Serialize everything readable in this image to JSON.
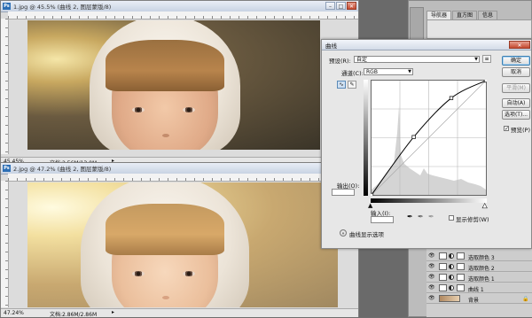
{
  "doc1": {
    "title": "1.jpg @ 45.5% (曲线 2, 图层蒙版/8)",
    "zoom": "45.45%",
    "info": "文档:2.56M/13.0M"
  },
  "doc2": {
    "title": "2.jpg @ 47.2% (曲线 2, 图层蒙版/8)",
    "zoom": "47.24%",
    "info": "文档:2.86M/2.86M"
  },
  "panel_tabs": [
    {
      "label": "导航器",
      "active": true
    },
    {
      "label": "直方图",
      "active": false
    },
    {
      "label": "信息",
      "active": false
    }
  ],
  "curves": {
    "title": "曲线",
    "preset_label": "预设(R):",
    "preset_value": "自定",
    "channel_label": "通道(C):",
    "channel_value": "RGB",
    "output_label": "输出(O):",
    "input_label": "输入(I):",
    "show_clipping": "显示修剪(W)",
    "display_options": "曲线显示选项",
    "buttons": {
      "ok": "确定",
      "cancel": "取消",
      "smooth": "平滑(M)",
      "auto": "自动(A)",
      "options": "选项(T)..."
    },
    "preview_label": "预览(P)",
    "preview_checked": true,
    "points": [
      [
        0,
        0
      ],
      [
        94,
        129
      ],
      [
        178,
        216
      ],
      [
        255,
        255
      ]
    ]
  },
  "layers": [
    {
      "name": "选取颜色 3"
    },
    {
      "name": "选取颜色 2"
    },
    {
      "name": "选取颜色 1"
    },
    {
      "name": "曲线 1"
    },
    {
      "name": "背景"
    }
  ]
}
